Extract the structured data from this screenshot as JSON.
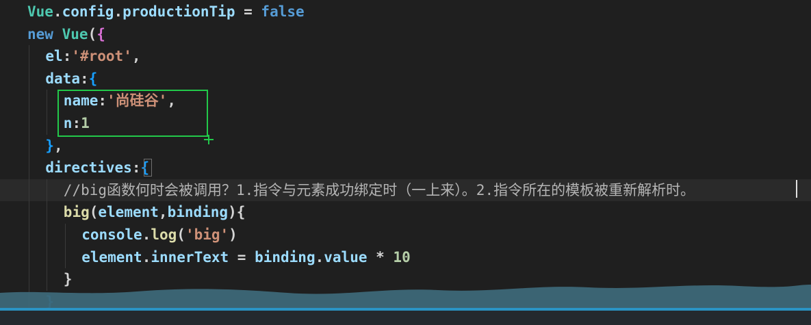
{
  "editor": {
    "lines": [
      {
        "indent": 1,
        "tokens": [
          {
            "t": "Vue",
            "c": "t-obj"
          },
          {
            "t": ".",
            "c": "t-punc"
          },
          {
            "t": "config",
            "c": "t-prop"
          },
          {
            "t": ".",
            "c": "t-punc"
          },
          {
            "t": "productionTip",
            "c": "t-prop"
          },
          {
            "t": " = ",
            "c": "t-punc"
          },
          {
            "t": "false",
            "c": "t-kw"
          }
        ]
      },
      {
        "indent": 1,
        "tokens": [
          {
            "t": "new",
            "c": "t-kw"
          },
          {
            "t": " ",
            "c": "t-punc"
          },
          {
            "t": "Vue",
            "c": "t-obj"
          },
          {
            "t": "(",
            "c": "t-punc"
          },
          {
            "t": "{",
            "c": "t-brace2"
          }
        ]
      },
      {
        "indent": 2,
        "tokens": [
          {
            "t": "el",
            "c": "t-prop"
          },
          {
            "t": ":",
            "c": "t-punc"
          },
          {
            "t": "'#root'",
            "c": "t-str"
          },
          {
            "t": ",",
            "c": "t-punc"
          }
        ]
      },
      {
        "indent": 2,
        "tokens": [
          {
            "t": "data",
            "c": "t-prop"
          },
          {
            "t": ":",
            "c": "t-punc"
          },
          {
            "t": "{",
            "c": "t-brace3"
          }
        ]
      },
      {
        "indent": 3,
        "tokens": [
          {
            "t": "name",
            "c": "t-prop"
          },
          {
            "t": ":",
            "c": "t-punc"
          },
          {
            "t": "'尚硅谷'",
            "c": "t-str"
          },
          {
            "t": ",",
            "c": "t-punc"
          }
        ]
      },
      {
        "indent": 3,
        "tokens": [
          {
            "t": "n",
            "c": "t-prop"
          },
          {
            "t": ":",
            "c": "t-punc"
          },
          {
            "t": "1",
            "c": "t-num"
          }
        ]
      },
      {
        "indent": 2,
        "tokens": [
          {
            "t": "}",
            "c": "t-brace3"
          },
          {
            "t": ",",
            "c": "t-punc"
          }
        ]
      },
      {
        "indent": 2,
        "tokens": [
          {
            "t": "directives",
            "c": "t-prop"
          },
          {
            "t": ":",
            "c": "t-punc"
          },
          {
            "t": "{",
            "c": "t-brace3"
          }
        ]
      },
      {
        "indent": 3,
        "highlight": true,
        "tokens": [
          {
            "t": "//big函数何时会被调用？1.指令与元素成功绑定时（一上来）。2.指令所在的模板被重新解析时。",
            "c": "t-cmt"
          }
        ]
      },
      {
        "indent": 3,
        "tokens": [
          {
            "t": "big",
            "c": "t-func"
          },
          {
            "t": "(",
            "c": "t-punc"
          },
          {
            "t": "element",
            "c": "t-ident"
          },
          {
            "t": ",",
            "c": "t-punc"
          },
          {
            "t": "binding",
            "c": "t-ident"
          },
          {
            "t": "){",
            "c": "t-punc"
          }
        ]
      },
      {
        "indent": 4,
        "tokens": [
          {
            "t": "console",
            "c": "t-ident"
          },
          {
            "t": ".",
            "c": "t-punc"
          },
          {
            "t": "log",
            "c": "t-func"
          },
          {
            "t": "(",
            "c": "t-punc"
          },
          {
            "t": "'big'",
            "c": "t-str"
          },
          {
            "t": ")",
            "c": "t-punc"
          }
        ]
      },
      {
        "indent": 4,
        "tokens": [
          {
            "t": "element",
            "c": "t-ident"
          },
          {
            "t": ".",
            "c": "t-punc"
          },
          {
            "t": "innerText",
            "c": "t-prop"
          },
          {
            "t": " = ",
            "c": "t-punc"
          },
          {
            "t": "binding",
            "c": "t-ident"
          },
          {
            "t": ".",
            "c": "t-punc"
          },
          {
            "t": "value",
            "c": "t-prop"
          },
          {
            "t": " * ",
            "c": "t-punc"
          },
          {
            "t": "10",
            "c": "t-num"
          }
        ]
      },
      {
        "indent": 3,
        "tokens": [
          {
            "t": "}",
            "c": "t-punc"
          }
        ]
      },
      {
        "indent": 2,
        "tokens": [
          {
            "t": "}",
            "c": "t-brace3"
          }
        ]
      },
      {
        "indent": 1,
        "tokens": [
          {
            "t": "})",
            "c": "t-brace2"
          }
        ]
      }
    ]
  },
  "colors": {
    "selection_box": "#22c94a",
    "background": "#1f1f1f",
    "overlay_wave": "#3f6a7a"
  }
}
